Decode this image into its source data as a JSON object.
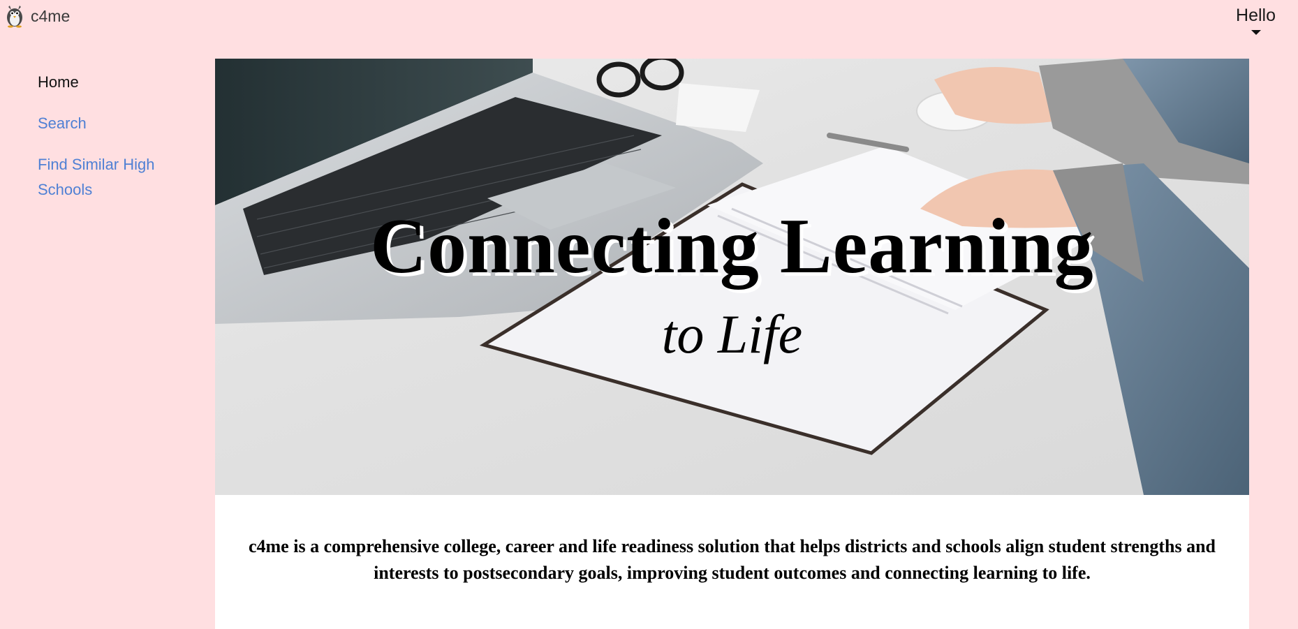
{
  "header": {
    "brand_name": "c4me",
    "logo_icon": "penguin-logo-icon",
    "user_greeting": "Hello",
    "menu_icon": "caret-down-icon"
  },
  "sidebar": {
    "items": [
      {
        "label": "Home",
        "active": true
      },
      {
        "label": "Search",
        "active": false
      },
      {
        "label": "Find Similar High Schools",
        "active": false
      }
    ]
  },
  "hero": {
    "title": "Connecting Learning",
    "subtitle": "to Life",
    "image": "laptop-notebook-desk-photo"
  },
  "main": {
    "tagline": "c4me is a comprehensive college, career and life readiness solution that helps districts and schools align student strengths and interests to postsecondary goals, improving student outcomes and connecting learning to life."
  },
  "colors": {
    "background": "#ffdfe1",
    "link": "#4f80d4",
    "active_link": "#111111"
  }
}
